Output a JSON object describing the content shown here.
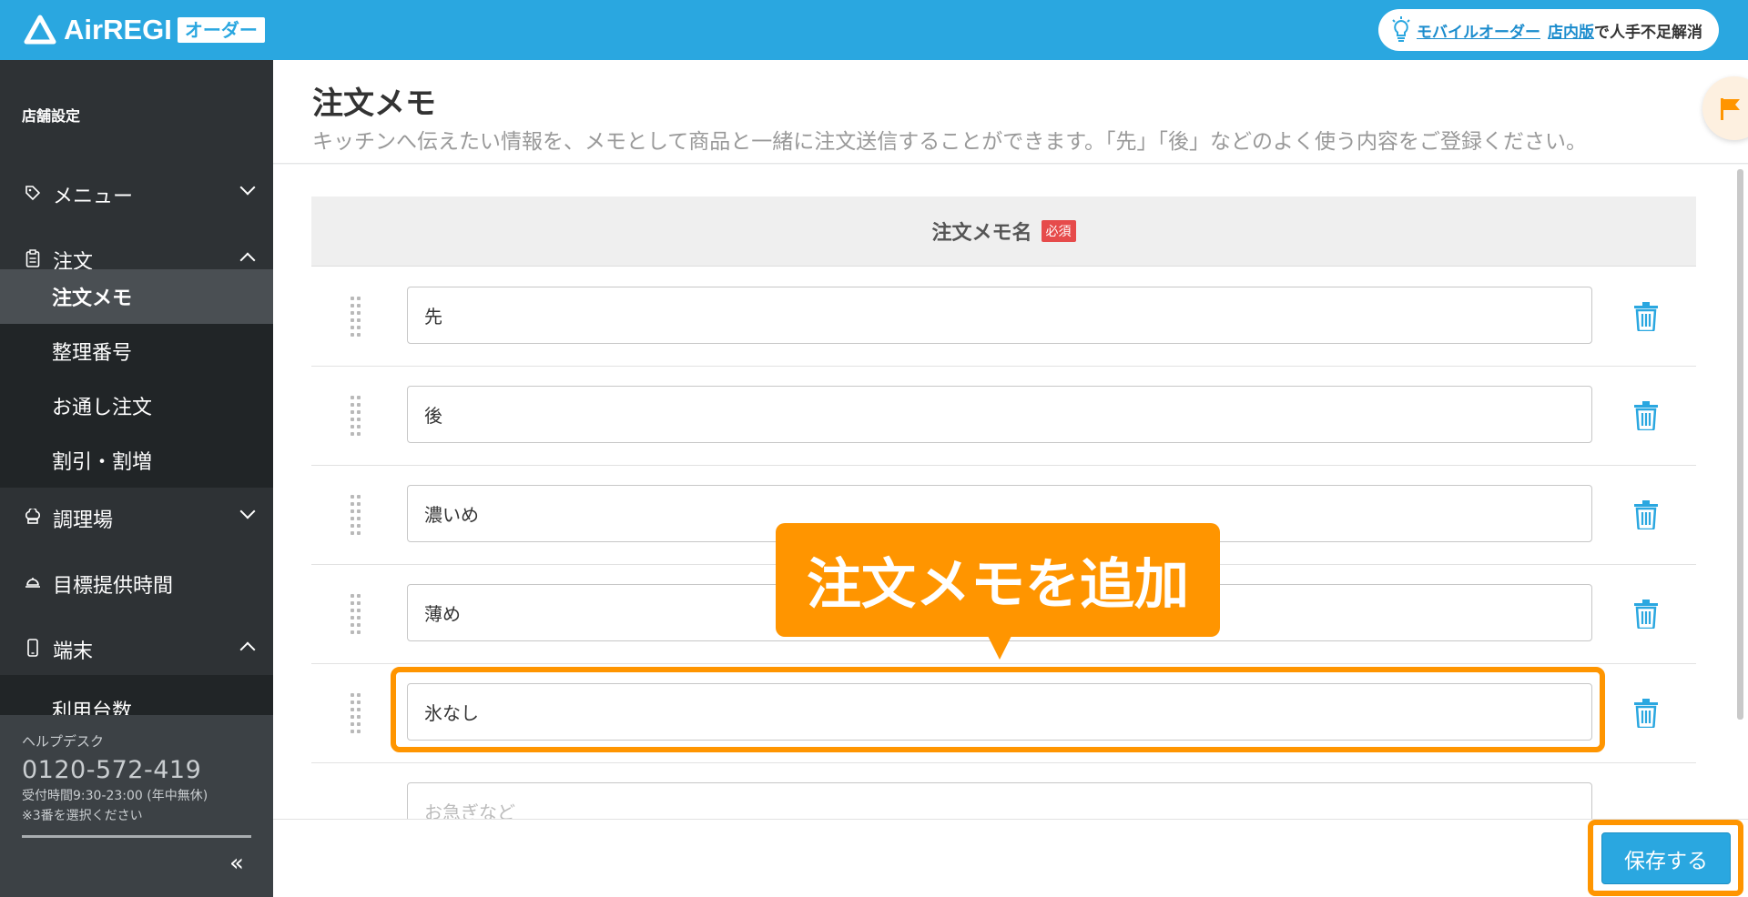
{
  "header": {
    "logo_text": "AirREGI",
    "logo_badge": "オーダー",
    "promo_link1": "モバイルオーダー",
    "promo_link2": "店内版",
    "promo_text": "で人手不足解消"
  },
  "sidebar": {
    "section_title": "店舗設定",
    "items": [
      {
        "label": "メニュー",
        "icon": "tag-icon",
        "state": "collapsed"
      },
      {
        "label": "注文",
        "icon": "clipboard-icon",
        "state": "expanded"
      },
      {
        "label": "調理場",
        "icon": "chef-hat-icon",
        "state": "collapsed"
      },
      {
        "label": "目標提供時間",
        "icon": "cloche-icon",
        "state": "none"
      },
      {
        "label": "端末",
        "icon": "phone-icon",
        "state": "expanded"
      }
    ],
    "order_sub": [
      "注文メモ",
      "整理番号",
      "お通し注文",
      "割引・割増"
    ],
    "terminal_sub": [
      "利用台数"
    ],
    "helpdesk": {
      "label": "ヘルプデスク",
      "phone": "0120-572-419",
      "hours": "受付時間9:30-23:00 (年中無休)",
      "note": "※3番を選択ください"
    },
    "collapse_glyph": "«"
  },
  "page": {
    "title": "注文メモ",
    "description": "キッチンへ伝えたい情報を、メモとして商品と一緒に注文送信することができます。「先」「後」などのよく使う内容をご登録ください。"
  },
  "table": {
    "column_header": "注文メモ名",
    "required_badge": "必須",
    "rows": [
      "先",
      "後",
      "濃いめ",
      "薄め",
      "氷なし"
    ],
    "new_row_placeholder": "お急ぎなど"
  },
  "callout": {
    "text": "注文メモを追加"
  },
  "footer": {
    "save_label": "保存する"
  },
  "colors": {
    "brand": "#2aa7e0",
    "highlight": "#ff9500",
    "sidebar_bg": "#2e3235",
    "required": "#e64b4b"
  }
}
